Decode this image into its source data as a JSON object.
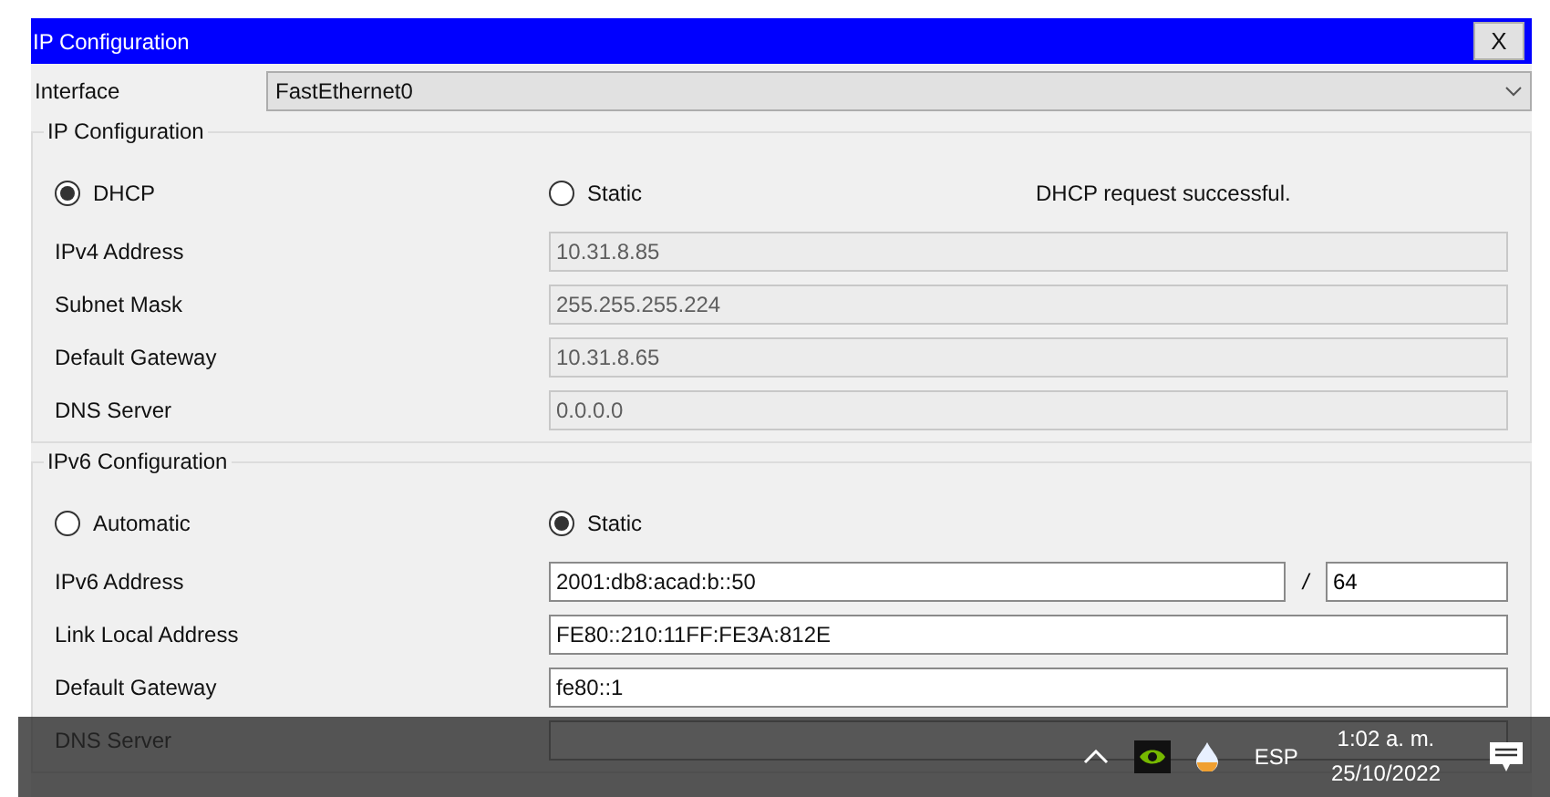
{
  "window": {
    "title": "IP Configuration",
    "close": "X"
  },
  "interface": {
    "label": "Interface",
    "value": "FastEthernet0"
  },
  "ipv4": {
    "title": "IP Configuration",
    "status": "DHCP request successful.",
    "modes": [
      {
        "label": "DHCP",
        "selected": true
      },
      {
        "label": "Static",
        "selected": false
      }
    ],
    "fields": [
      {
        "label": "IPv4 Address",
        "value": "10.31.8.85",
        "disabled": true
      },
      {
        "label": "Subnet Mask",
        "value": "255.255.255.224",
        "disabled": true
      },
      {
        "label": "Default Gateway",
        "value": "10.31.8.65",
        "disabled": true
      },
      {
        "label": "DNS Server",
        "value": "0.0.0.0",
        "disabled": true
      }
    ]
  },
  "ipv6": {
    "title": "IPv6 Configuration",
    "modes": [
      {
        "label": "Automatic",
        "selected": false
      },
      {
        "label": "Static",
        "selected": true
      }
    ],
    "fields": [
      {
        "label": "IPv6 Address",
        "value": "2001:db8:acad:b::50",
        "disabled": false,
        "separator": "/",
        "prefix": "64"
      },
      {
        "label": "Link Local Address",
        "value": "FE80::210:11FF:FE3A:812E",
        "disabled": false
      },
      {
        "label": "Default Gateway",
        "value": "fe80::1",
        "disabled": false
      },
      {
        "label": "DNS Server",
        "disabled": false
      }
    ]
  },
  "taskbar": {
    "language": "ESP",
    "time": "1:02 a. m.",
    "date": "25/10/2022"
  }
}
